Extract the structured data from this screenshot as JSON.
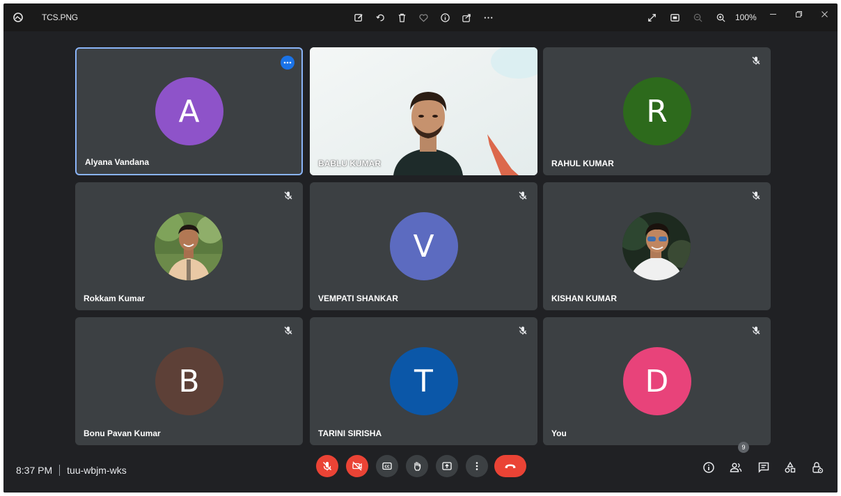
{
  "viewer": {
    "file_name": "TCS.PNG",
    "zoom_level": "100%",
    "toolbar_icons": [
      "edit-icon",
      "rotate-icon",
      "delete-icon",
      "favorite-icon",
      "info-icon",
      "share-icon",
      "more-icon"
    ],
    "right_icons": [
      "expand-icon",
      "fit-icon",
      "zoom-out-icon",
      "zoom-in-icon"
    ]
  },
  "meeting": {
    "time": "8:37 PM",
    "code": "tuu-wbjm-wks",
    "participant_count": "9"
  },
  "participants": [
    {
      "name": "Alyana Vandana",
      "initial": "A",
      "color": "#8e53c9",
      "type": "avatar",
      "muted": false,
      "active": true
    },
    {
      "name": "BABLU KUMAR",
      "initial": "",
      "color": "#e8e8e8",
      "type": "video",
      "muted": false,
      "active": false
    },
    {
      "name": "RAHUL KUMAR",
      "initial": "R",
      "color": "#2d6a1c",
      "type": "avatar",
      "muted": true,
      "active": false
    },
    {
      "name": "Rokkam Kumar",
      "initial": "",
      "color": "#6b8f4a",
      "type": "photo",
      "muted": true,
      "active": false
    },
    {
      "name": "VEMPATI SHANKAR",
      "initial": "V",
      "color": "#5c6bc0",
      "type": "avatar",
      "muted": true,
      "active": false
    },
    {
      "name": "KISHAN KUMAR",
      "initial": "",
      "color": "#2a3a2a",
      "type": "photo",
      "muted": true,
      "active": false
    },
    {
      "name": "Bonu Pavan Kumar",
      "initial": "B",
      "color": "#5d4037",
      "type": "avatar",
      "muted": true,
      "active": false
    },
    {
      "name": "TARINI SIRISHA",
      "initial": "T",
      "color": "#0b57a8",
      "type": "avatar",
      "muted": true,
      "active": false
    },
    {
      "name": "You",
      "initial": "D",
      "color": "#e8437a",
      "type": "avatar",
      "muted": true,
      "active": false
    }
  ],
  "controls": {
    "center": [
      "mic-off-icon",
      "camera-off-icon",
      "captions-icon",
      "raise-hand-icon",
      "present-icon",
      "more-options-icon",
      "hang-up-icon"
    ],
    "right": [
      "meeting-details-icon",
      "people-icon",
      "chat-icon",
      "activities-icon",
      "host-controls-icon"
    ]
  },
  "colors": {
    "background": "#202124",
    "tile": "#3c4043",
    "accent": "#8ab4f8",
    "danger": "#ea4335"
  }
}
